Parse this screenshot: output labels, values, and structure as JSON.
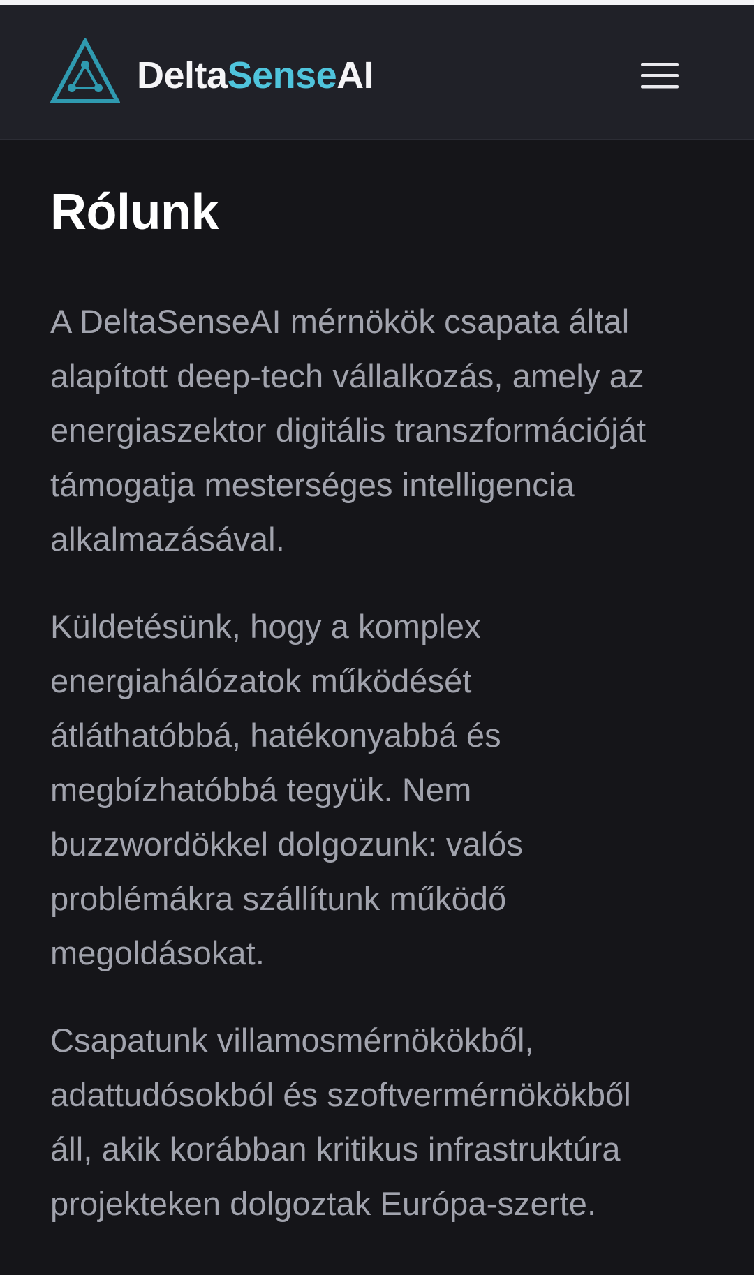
{
  "header": {
    "brand": {
      "part1": "Delta",
      "part2": "Sense",
      "part3": "AI"
    }
  },
  "main": {
    "title": "Rólunk",
    "paragraphs": [
      {
        "lines": [
          "A DeltaSenseAI mérnökök csapata által",
          "alapított deep-tech vállalkozás, amely az",
          "energiaszektor digitális transzformációját",
          "támogatja mesterséges intelligencia",
          "alkalmazásával."
        ]
      },
      {
        "lines": [
          "Küldetésünk, hogy a komplex",
          "energiahálózatok működését",
          "átláthatóbbá, hatékonyabbá és",
          "megbízhatóbbá tegyük. Nem",
          "buzzwordökkel dolgozunk: valós",
          "problémákra szállítunk működő",
          "megoldásokat."
        ]
      },
      {
        "lines": [
          "Csapatunk villamosmérnökökből,",
          "adattudósokból és szoftvermérnökökből",
          "áll, akik korábban kritikus infrastruktúra",
          "projekteken dolgoztak Európa-szerte."
        ]
      }
    ]
  },
  "colors": {
    "background": "#151519",
    "header_background": "#202128",
    "accent": "#4fc4dc",
    "text_primary": "#ffffff",
    "text_secondary": "#a1a3ad"
  },
  "icons": {
    "logo": "delta-triangle-logo-icon",
    "menu": "hamburger-menu-icon"
  }
}
